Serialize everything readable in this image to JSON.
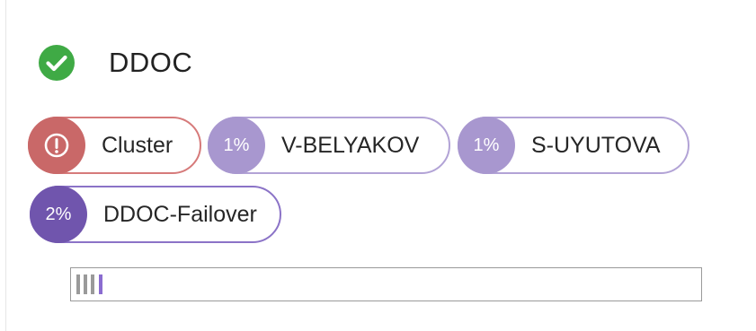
{
  "header": {
    "title": "DDOC",
    "status_icon": "check-circle-icon",
    "status_color": "#3faa45"
  },
  "pills": [
    {
      "badge_text": "",
      "badge_icon": "alert-circle-icon",
      "label": "Cluster",
      "badge_color": "#c96868",
      "border_color": "#d67a7a"
    },
    {
      "badge_text": "1%",
      "label": "V-BELYAKOV",
      "badge_color": "#a897cf",
      "border_color": "#b2a3d6"
    },
    {
      "badge_text": "1%",
      "label": "S-UYUTOVA",
      "badge_color": "#a897cf",
      "border_color": "#b2a3d6"
    },
    {
      "badge_text": "2%",
      "label": "DDOC-Failover",
      "badge_color": "#7055ad",
      "border_color": "#8b73c7"
    }
  ],
  "usage_bar": {
    "segments": [
      {
        "name": "Cluster",
        "color": "#9a9a9a"
      },
      {
        "name": "V-BELYAKOV",
        "color": "#9a9a9a"
      },
      {
        "name": "S-UYUTOVA",
        "color": "#9a9a9a"
      },
      {
        "name": "DDOC-Failover",
        "color": "#8a6cd0"
      }
    ]
  }
}
